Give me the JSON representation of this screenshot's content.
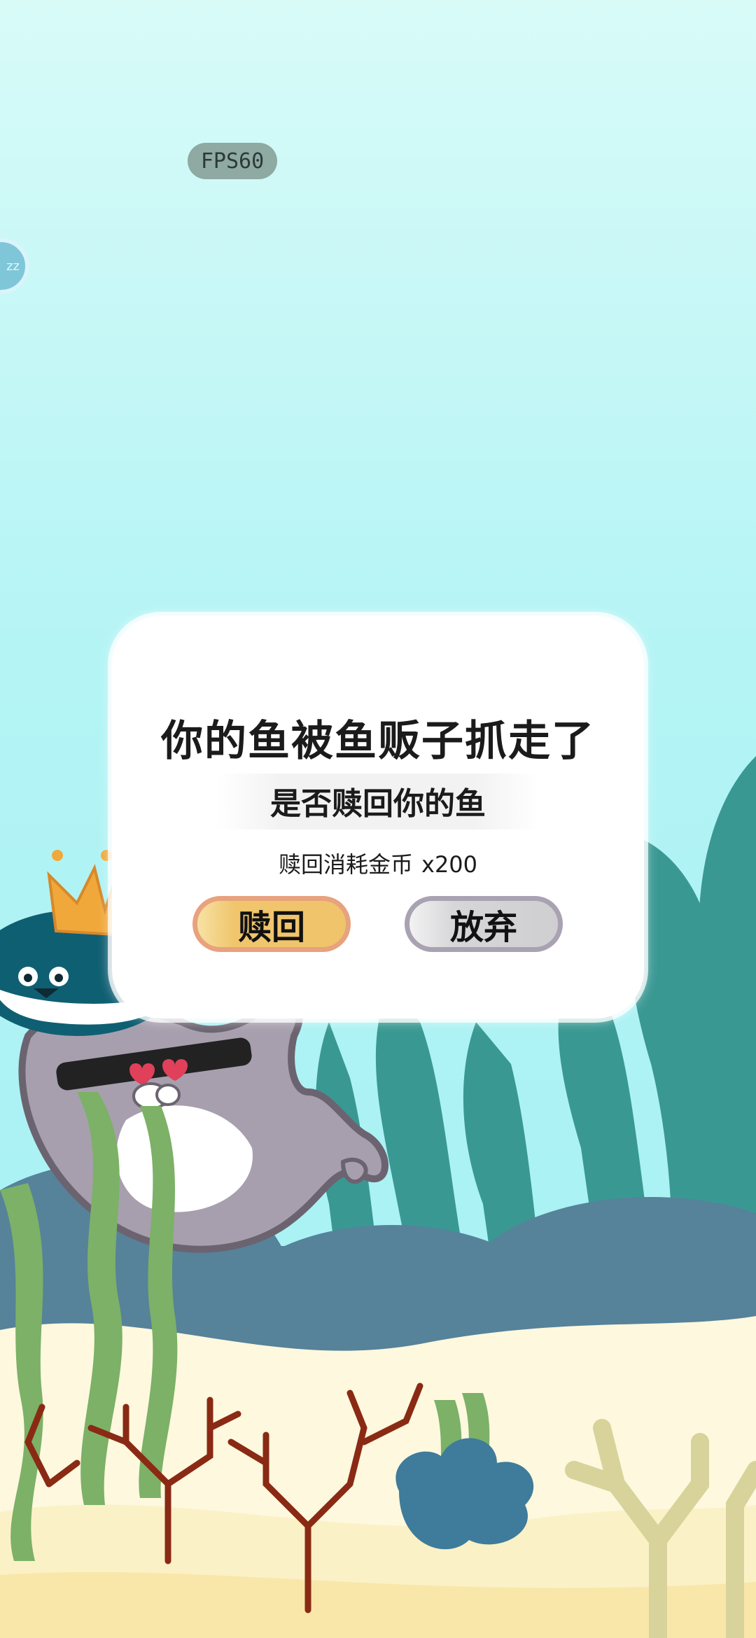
{
  "hud": {
    "fps_label": "FPS60",
    "side_button_label": "zz"
  },
  "dialog": {
    "title": "你的鱼被鱼贩子抓走了",
    "question": "是否赎回你的鱼",
    "cost_label": "赎回消耗金币",
    "cost_amount": "x200",
    "redeem_label": "赎回",
    "giveup_label": "放弃"
  },
  "colors": {
    "sky_top": "#d9fbf8",
    "sky_bottom": "#a6f1f3",
    "kelp_dark": "#3a9893",
    "rock_blue": "#56829a",
    "sand": "#fdf8df",
    "redeem_button": "#efc46b",
    "giveup_button": "#cfcfd2"
  },
  "icons": {
    "fish_character": "seal-thief-icon",
    "crown": "crown-icon"
  }
}
